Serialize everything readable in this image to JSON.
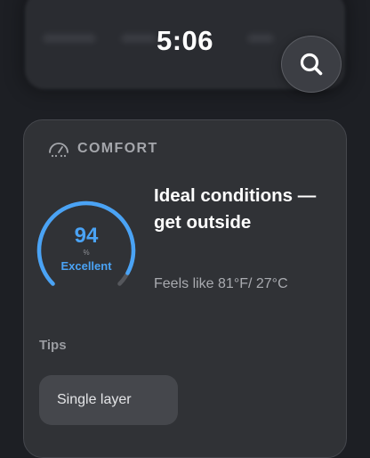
{
  "status_bar": {
    "time": "5:06"
  },
  "search": {
    "icon": "search-icon"
  },
  "comfort_card": {
    "header_icon": "gauge-icon",
    "title": "COMFORT",
    "score": "94",
    "score_unit": "%",
    "score_fraction": 0.94,
    "rating": "Excellent",
    "headline": "Ideal conditions — get outside",
    "feels_like": "Feels like 81°F/ 27°C",
    "tips_label": "Tips",
    "tips": [
      "Single layer"
    ]
  },
  "colors": {
    "background": "#1d1f24",
    "card": "#303236",
    "accent": "#4aa3f5",
    "gauge_track": "#55575c"
  }
}
